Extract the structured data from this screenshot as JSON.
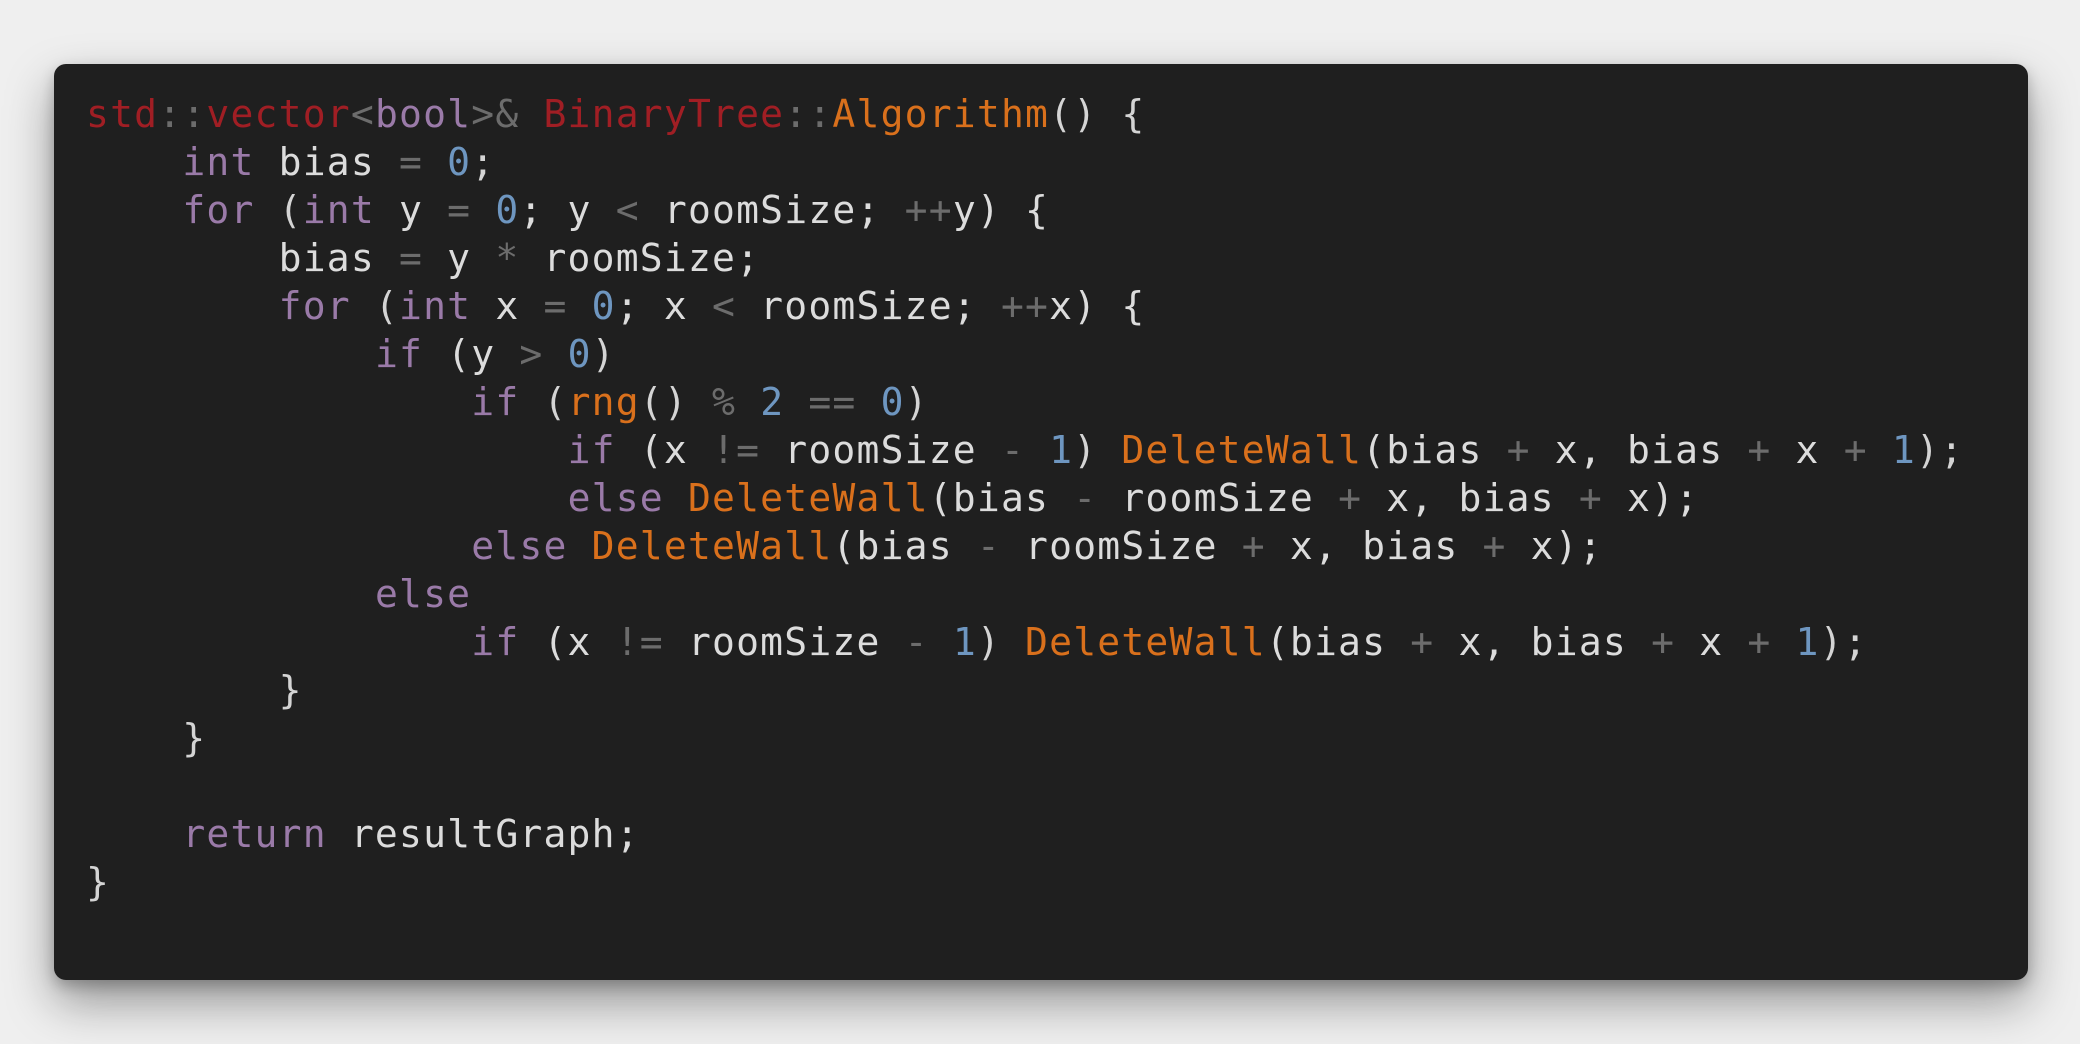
{
  "colors": {
    "background": "#efefef",
    "editor_background": "#1f1f1f",
    "keyword": "#9a7aa8",
    "type_namespace": "#a01e24",
    "function": "#d9701c",
    "number": "#6e96c0",
    "operator": "#6c6c6c",
    "identifier": "#dcdcdc"
  },
  "code": {
    "lines": [
      [
        {
          "text": "std",
          "class": "t"
        },
        {
          "text": "::",
          "class": "o"
        },
        {
          "text": "vector",
          "class": "t"
        },
        {
          "text": "<",
          "class": "o"
        },
        {
          "text": "bool",
          "class": "k"
        },
        {
          "text": ">&",
          "class": "o"
        },
        {
          "text": " ",
          "class": "p"
        },
        {
          "text": "BinaryTree",
          "class": "t"
        },
        {
          "text": "::",
          "class": "o"
        },
        {
          "text": "Algorithm",
          "class": "f"
        },
        {
          "text": "() {",
          "class": "p"
        }
      ],
      [
        {
          "text": "    ",
          "class": "p"
        },
        {
          "text": "int",
          "class": "k"
        },
        {
          "text": " bias ",
          "class": "i"
        },
        {
          "text": "=",
          "class": "o"
        },
        {
          "text": " ",
          "class": "p"
        },
        {
          "text": "0",
          "class": "n"
        },
        {
          "text": ";",
          "class": "p"
        }
      ],
      [
        {
          "text": "    ",
          "class": "p"
        },
        {
          "text": "for",
          "class": "k"
        },
        {
          "text": " (",
          "class": "p"
        },
        {
          "text": "int",
          "class": "k"
        },
        {
          "text": " y ",
          "class": "i"
        },
        {
          "text": "=",
          "class": "o"
        },
        {
          "text": " ",
          "class": "p"
        },
        {
          "text": "0",
          "class": "n"
        },
        {
          "text": "; y ",
          "class": "i"
        },
        {
          "text": "<",
          "class": "o"
        },
        {
          "text": " roomSize; ",
          "class": "i"
        },
        {
          "text": "++",
          "class": "o"
        },
        {
          "text": "y) {",
          "class": "i"
        }
      ],
      [
        {
          "text": "        bias ",
          "class": "i"
        },
        {
          "text": "=",
          "class": "o"
        },
        {
          "text": " y ",
          "class": "i"
        },
        {
          "text": "*",
          "class": "o"
        },
        {
          "text": " roomSize;",
          "class": "i"
        }
      ],
      [
        {
          "text": "        ",
          "class": "p"
        },
        {
          "text": "for",
          "class": "k"
        },
        {
          "text": " (",
          "class": "p"
        },
        {
          "text": "int",
          "class": "k"
        },
        {
          "text": " x ",
          "class": "i"
        },
        {
          "text": "=",
          "class": "o"
        },
        {
          "text": " ",
          "class": "p"
        },
        {
          "text": "0",
          "class": "n"
        },
        {
          "text": "; x ",
          "class": "i"
        },
        {
          "text": "<",
          "class": "o"
        },
        {
          "text": " roomSize; ",
          "class": "i"
        },
        {
          "text": "++",
          "class": "o"
        },
        {
          "text": "x) {",
          "class": "i"
        }
      ],
      [
        {
          "text": "            ",
          "class": "p"
        },
        {
          "text": "if",
          "class": "k"
        },
        {
          "text": " (y ",
          "class": "i"
        },
        {
          "text": ">",
          "class": "o"
        },
        {
          "text": " ",
          "class": "p"
        },
        {
          "text": "0",
          "class": "n"
        },
        {
          "text": ")",
          "class": "p"
        }
      ],
      [
        {
          "text": "                ",
          "class": "p"
        },
        {
          "text": "if",
          "class": "k"
        },
        {
          "text": " (",
          "class": "p"
        },
        {
          "text": "rng",
          "class": "f"
        },
        {
          "text": "() ",
          "class": "p"
        },
        {
          "text": "%",
          "class": "o"
        },
        {
          "text": " ",
          "class": "p"
        },
        {
          "text": "2",
          "class": "n"
        },
        {
          "text": " ",
          "class": "p"
        },
        {
          "text": "==",
          "class": "o"
        },
        {
          "text": " ",
          "class": "p"
        },
        {
          "text": "0",
          "class": "n"
        },
        {
          "text": ")",
          "class": "p"
        }
      ],
      [
        {
          "text": "                    ",
          "class": "p"
        },
        {
          "text": "if",
          "class": "k"
        },
        {
          "text": " (x ",
          "class": "i"
        },
        {
          "text": "!=",
          "class": "o"
        },
        {
          "text": " roomSize ",
          "class": "i"
        },
        {
          "text": "-",
          "class": "o"
        },
        {
          "text": " ",
          "class": "p"
        },
        {
          "text": "1",
          "class": "n"
        },
        {
          "text": ") ",
          "class": "p"
        },
        {
          "text": "DeleteWall",
          "class": "f"
        },
        {
          "text": "(bias ",
          "class": "i"
        },
        {
          "text": "+",
          "class": "o"
        },
        {
          "text": " x, bias ",
          "class": "i"
        },
        {
          "text": "+",
          "class": "o"
        },
        {
          "text": " x ",
          "class": "i"
        },
        {
          "text": "+",
          "class": "o"
        },
        {
          "text": " ",
          "class": "p"
        },
        {
          "text": "1",
          "class": "n"
        },
        {
          "text": ");",
          "class": "p"
        }
      ],
      [
        {
          "text": "                    ",
          "class": "p"
        },
        {
          "text": "else",
          "class": "k"
        },
        {
          "text": " ",
          "class": "p"
        },
        {
          "text": "DeleteWall",
          "class": "f"
        },
        {
          "text": "(bias ",
          "class": "i"
        },
        {
          "text": "-",
          "class": "o"
        },
        {
          "text": " roomSize ",
          "class": "i"
        },
        {
          "text": "+",
          "class": "o"
        },
        {
          "text": " x, bias ",
          "class": "i"
        },
        {
          "text": "+",
          "class": "o"
        },
        {
          "text": " x);",
          "class": "i"
        }
      ],
      [
        {
          "text": "                ",
          "class": "p"
        },
        {
          "text": "else",
          "class": "k"
        },
        {
          "text": " ",
          "class": "p"
        },
        {
          "text": "DeleteWall",
          "class": "f"
        },
        {
          "text": "(bias ",
          "class": "i"
        },
        {
          "text": "-",
          "class": "o"
        },
        {
          "text": " roomSize ",
          "class": "i"
        },
        {
          "text": "+",
          "class": "o"
        },
        {
          "text": " x, bias ",
          "class": "i"
        },
        {
          "text": "+",
          "class": "o"
        },
        {
          "text": " x);",
          "class": "i"
        }
      ],
      [
        {
          "text": "            ",
          "class": "p"
        },
        {
          "text": "else",
          "class": "k"
        }
      ],
      [
        {
          "text": "                ",
          "class": "p"
        },
        {
          "text": "if",
          "class": "k"
        },
        {
          "text": " (x ",
          "class": "i"
        },
        {
          "text": "!=",
          "class": "o"
        },
        {
          "text": " roomSize ",
          "class": "i"
        },
        {
          "text": "-",
          "class": "o"
        },
        {
          "text": " ",
          "class": "p"
        },
        {
          "text": "1",
          "class": "n"
        },
        {
          "text": ") ",
          "class": "p"
        },
        {
          "text": "DeleteWall",
          "class": "f"
        },
        {
          "text": "(bias ",
          "class": "i"
        },
        {
          "text": "+",
          "class": "o"
        },
        {
          "text": " x, bias ",
          "class": "i"
        },
        {
          "text": "+",
          "class": "o"
        },
        {
          "text": " x ",
          "class": "i"
        },
        {
          "text": "+",
          "class": "o"
        },
        {
          "text": " ",
          "class": "p"
        },
        {
          "text": "1",
          "class": "n"
        },
        {
          "text": ");",
          "class": "p"
        }
      ],
      [
        {
          "text": "        }",
          "class": "p"
        }
      ],
      [
        {
          "text": "    }",
          "class": "p"
        }
      ],
      [],
      [
        {
          "text": "    ",
          "class": "p"
        },
        {
          "text": "return",
          "class": "k"
        },
        {
          "text": " resultGraph;",
          "class": "i"
        }
      ],
      [
        {
          "text": "}",
          "class": "p"
        }
      ]
    ]
  }
}
